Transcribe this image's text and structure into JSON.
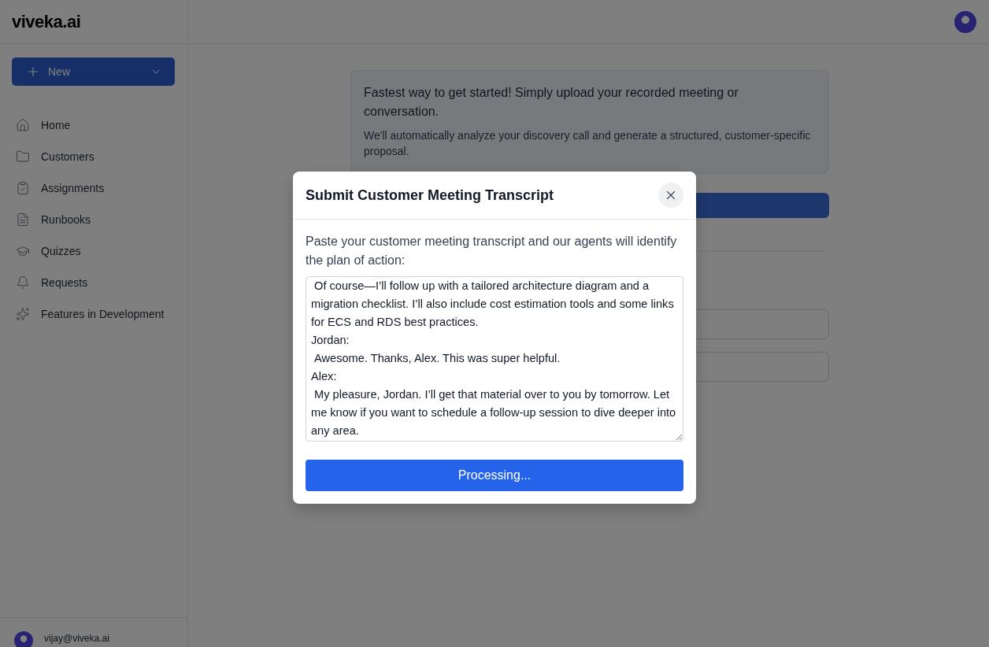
{
  "app": {
    "logo": "viveka.ai"
  },
  "new_button": {
    "label": "New"
  },
  "sidebar": {
    "items": [
      {
        "label": "Home",
        "kind": "home",
        "selected": false
      },
      {
        "label": "Customers",
        "kind": "folder",
        "selected": false
      },
      {
        "label": "Assignments",
        "kind": "clipboard",
        "selected": false
      },
      {
        "label": "Runbooks",
        "kind": "file",
        "selected": false
      },
      {
        "label": "Quizzes",
        "kind": "cap",
        "selected": false
      },
      {
        "label": "Requests",
        "kind": "bell",
        "selected": false
      },
      {
        "label": "Features in Development",
        "kind": "sparkles",
        "selected": false
      }
    ]
  },
  "user": {
    "email": "vijay@viveka.ai"
  },
  "intro_card": {
    "title": "Fastest way to get started! Simply upload your recorded meeting or conversation.",
    "text": "We'll automatically analyze your discovery call and generate a structured, customer-specific proposal."
  },
  "dialog": {
    "title": "Submit Customer Meeting Transcript",
    "description": "Paste your customer meeting transcript and our agents will identify the plan of action:",
    "transcript": " Of course—I’ll follow up with a tailored architecture diagram and a migration checklist. I’ll also include cost estimation tools and some links for ECS and RDS best practices.\nJordan:\n Awesome. Thanks, Alex. This was super helpful.\nAlex:\n My pleasure, Jordan. I’ll get that material over to you by tomorrow. Let me know if you want to schedule a follow-up session to dive deeper into any area.",
    "submit_label": "Processing...",
    "processing": true
  }
}
